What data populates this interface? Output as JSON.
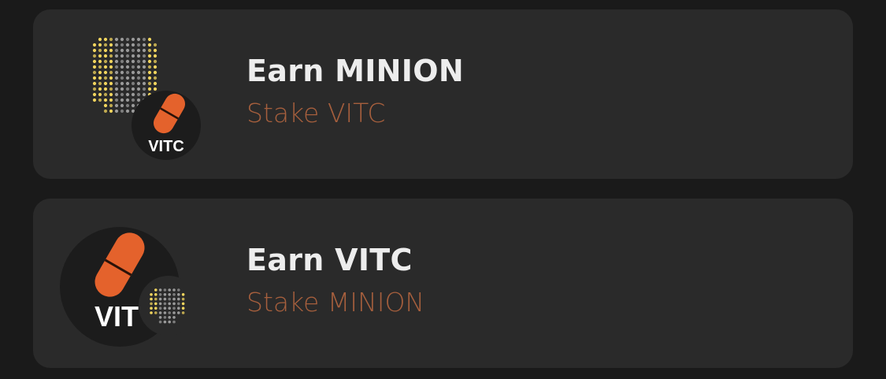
{
  "pools": [
    {
      "title": "Earn MINION",
      "subtitle": "Stake VITC",
      "primary_logo": "minion-dot-logo",
      "secondary_logo": "vitc-pill-logo",
      "badge_text": "VITC"
    },
    {
      "title": "Earn VITC",
      "subtitle": "Stake MINION",
      "primary_logo": "vitc-pill-logo",
      "secondary_logo": "minion-dot-logo",
      "badge_text": "VIT"
    }
  ],
  "colors": {
    "background": "#1a1a1a",
    "card": "#2a2a2a",
    "title": "#ededed",
    "subtitle": "#a65f3d",
    "pill": "#e4622c",
    "dot_yellow": "#f1d45e",
    "dot_gray": "#9a9a9a"
  }
}
